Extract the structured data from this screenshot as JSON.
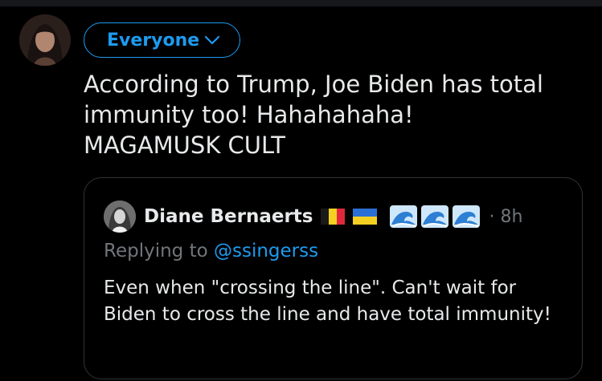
{
  "post": {
    "audience_label": "Everyone",
    "text": "According to Trump, Joe Biden has total\nimmunity too! Hahahahaha!\nMAGAMUSK CULT"
  },
  "quote": {
    "author_name": "Diane Bernaerts",
    "flags": [
      "belgium-flag",
      "ukraine-flag"
    ],
    "emojis": [
      "water-wave-emoji",
      "water-wave-emoji",
      "water-wave-emoji"
    ],
    "time": "· 8h",
    "replying_prefix": "Replying to",
    "replying_handle": "@ssingerss",
    "text": "Even when \"crossing the line\". Can't wait for Biden to cross the line and have total immunity!"
  },
  "colors": {
    "accent": "#1d9bf0",
    "text": "#e7e9ea",
    "muted": "#71767b",
    "border": "#2f3336",
    "background": "#000000"
  }
}
